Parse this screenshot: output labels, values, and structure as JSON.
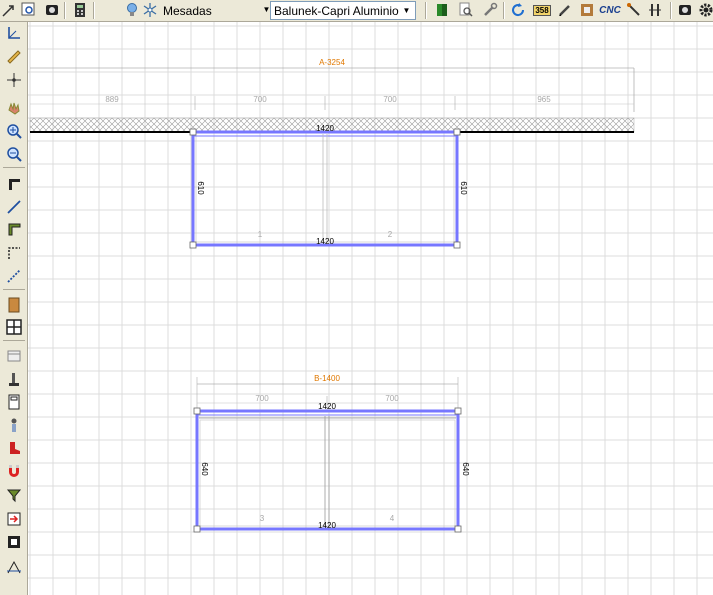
{
  "toolbar": {
    "mesadas_label": "Mesadas",
    "material_label": "Balunek-Capri Aluminio",
    "cnc_label": "CNC",
    "badge_label": "358"
  },
  "drawing": {
    "group_a": {
      "title": "A-3254",
      "segments": [
        "889",
        "700",
        "700",
        "965"
      ],
      "top_length": "1420",
      "bottom_length": "1420",
      "left_depth": "610",
      "right_depth": "610",
      "piece_labels": [
        "1",
        "2"
      ]
    },
    "group_b": {
      "title": "B-1400",
      "segments": [
        "700",
        "700"
      ],
      "top_length": "1420",
      "bottom_length": "1420",
      "left_depth": "640",
      "right_depth": "640",
      "piece_labels": [
        "3",
        "4"
      ]
    }
  },
  "colors": {
    "outline": "#7777ff",
    "dimension_title": "#e07800",
    "grid": "#dcdcdc"
  }
}
